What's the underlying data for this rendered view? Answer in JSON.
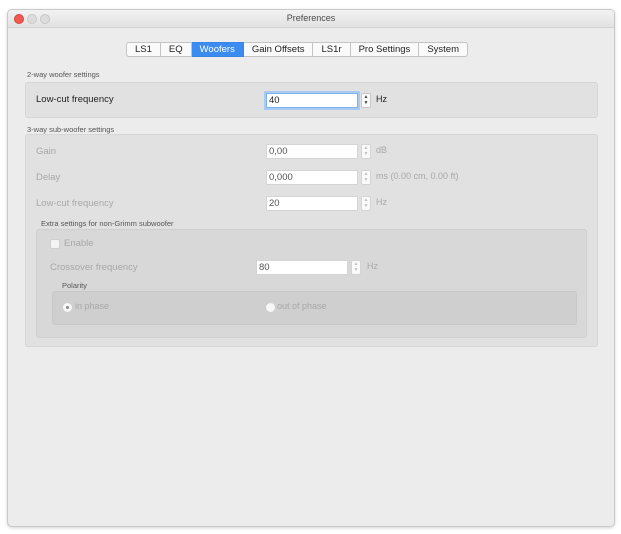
{
  "window": {
    "title": "Preferences"
  },
  "tabs": [
    {
      "label": "LS1"
    },
    {
      "label": "EQ"
    },
    {
      "label": "Woofers"
    },
    {
      "label": "Gain Offsets"
    },
    {
      "label": "LS1r"
    },
    {
      "label": "Pro Settings"
    },
    {
      "label": "System"
    }
  ],
  "active_tab": "Woofers",
  "two_way": {
    "heading": "2-way woofer settings",
    "lowcut_label": "Low-cut frequency",
    "lowcut_value": "40",
    "lowcut_unit": "Hz"
  },
  "three_way": {
    "heading": "3-way sub-woofer settings",
    "gain_label": "Gain",
    "gain_value": "0,00",
    "gain_unit": "dB",
    "delay_label": "Delay",
    "delay_value": "0,000",
    "delay_unit": "ms (0.00 cm, 0.00 ft)",
    "lowcut_label": "Low-cut frequency",
    "lowcut_value": "20",
    "lowcut_unit": "Hz"
  },
  "extra": {
    "heading": "Extra settings for non-Grimm subwoofer",
    "enable_label": "Enable",
    "crossover_label": "Crossover frequency",
    "crossover_value": "80",
    "crossover_unit": "Hz",
    "polarity_heading": "Polarity",
    "in_phase_label": "in phase",
    "out_of_phase_label": "out of phase"
  }
}
